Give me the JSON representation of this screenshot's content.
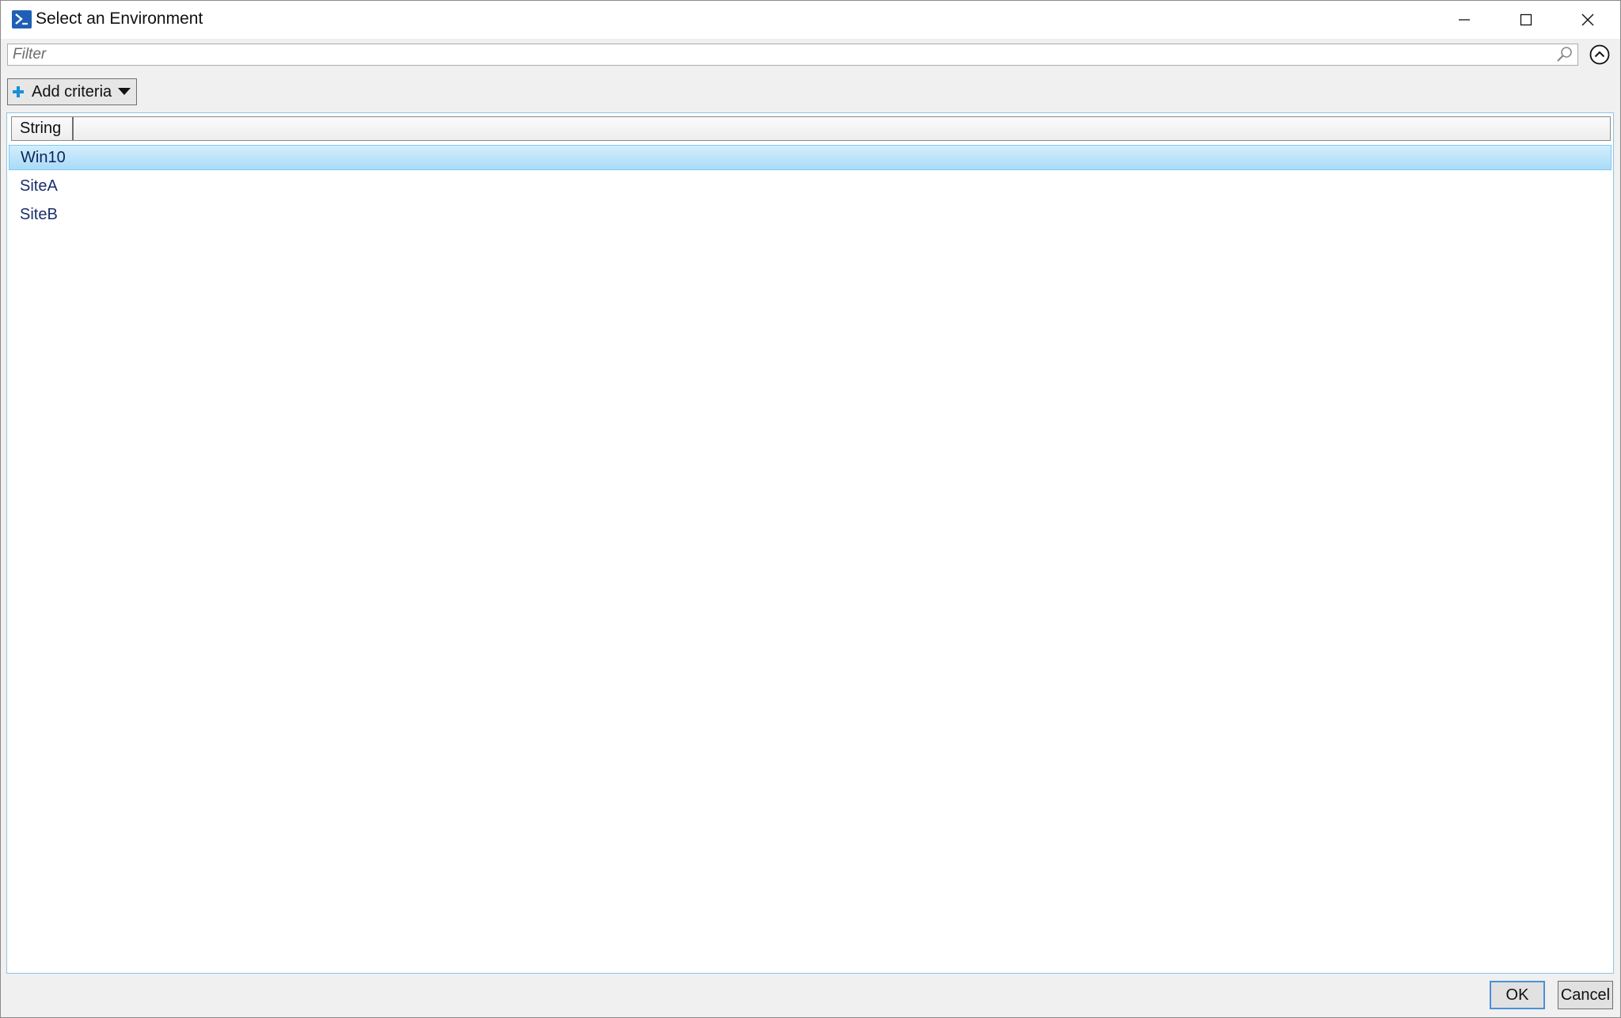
{
  "window": {
    "title": "Select an Environment",
    "app_icon": "powershell-icon",
    "controls": [
      "minimize-icon",
      "maximize-icon",
      "close-icon"
    ]
  },
  "filter": {
    "placeholder": "Filter",
    "value": "",
    "search_icon": "magnifier-icon",
    "collapse_icon": "chevron-up-circle-icon"
  },
  "criteria": {
    "label": "Add criteria",
    "icon": "plus-icon"
  },
  "list": {
    "columns": [
      {
        "label": "String"
      }
    ],
    "rows": [
      {
        "value": "Win10",
        "selected": true
      },
      {
        "value": "SiteA",
        "selected": false
      },
      {
        "value": "SiteB",
        "selected": false
      }
    ]
  },
  "footer": {
    "ok_label": "OK",
    "cancel_label": "Cancel"
  },
  "colors": {
    "selection": "#a9dbf8",
    "accent": "#4a90d9",
    "row_text": "#1a2f6b"
  }
}
